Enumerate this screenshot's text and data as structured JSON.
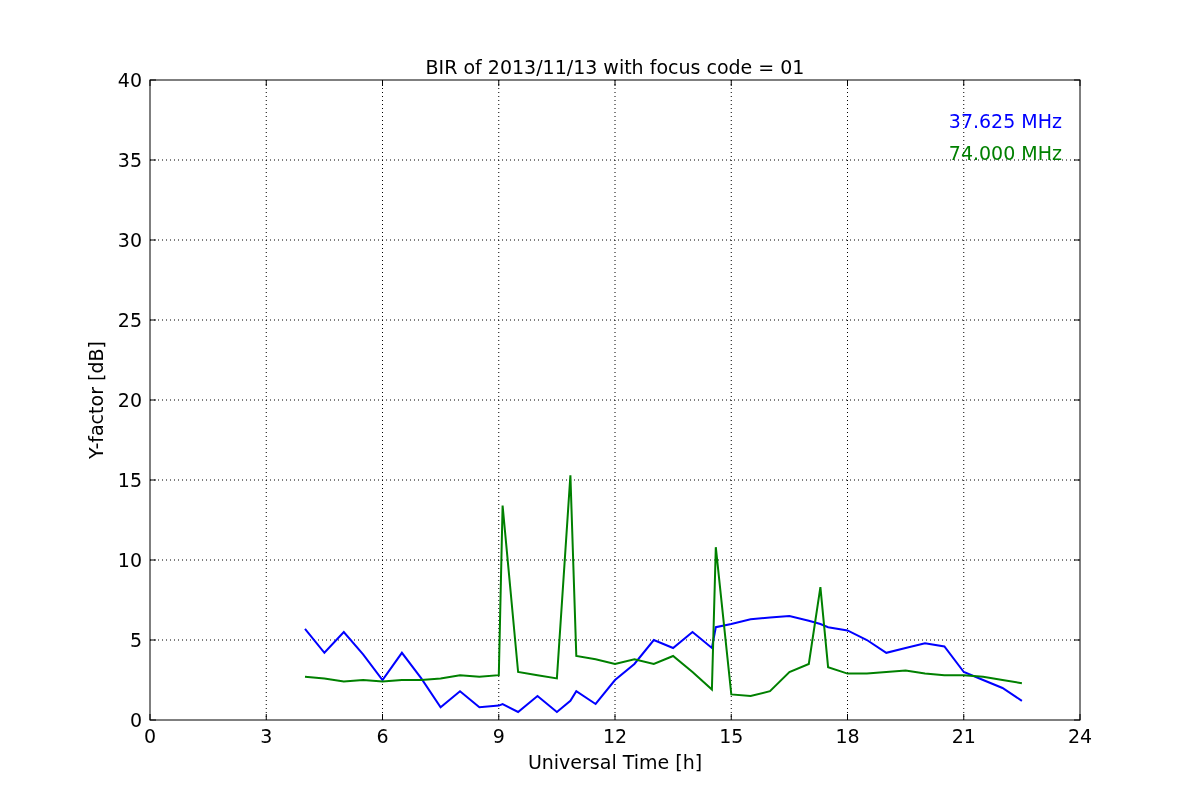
{
  "chart": {
    "chart_data": {
      "type": "line",
      "title": "BIR of 2013/11/13 with focus code = 01",
      "xlabel": "Universal Time [h]",
      "ylabel": "Y-factor [dB]",
      "x": [
        4,
        4.5,
        5,
        5.5,
        6,
        6.5,
        7,
        7.5,
        8,
        8.5,
        9,
        9.1,
        9.5,
        10,
        10.5,
        10.85,
        11,
        11.5,
        12,
        12.5,
        13,
        13.5,
        14,
        14.5,
        14.6,
        15,
        15.5,
        16,
        16.5,
        17,
        17.3,
        17.5,
        18,
        18.5,
        19,
        19.5,
        20,
        20.5,
        21,
        21.5,
        22,
        22.5
      ],
      "series": [
        {
          "name": "37.625 MHz",
          "color": "#0000ff",
          "values": [
            5.7,
            4.2,
            5.5,
            4.1,
            2.5,
            4.2,
            2.6,
            0.8,
            1.8,
            0.8,
            0.9,
            1.0,
            0.5,
            1.5,
            0.5,
            1.2,
            1.8,
            1.0,
            2.5,
            3.5,
            5.0,
            4.5,
            5.5,
            4.5,
            5.8,
            6.0,
            6.3,
            6.4,
            6.5,
            6.2,
            6.0,
            5.8,
            5.6,
            5.0,
            4.2,
            4.5,
            4.8,
            4.6,
            3.0,
            2.5,
            2.0,
            1.2
          ]
        },
        {
          "name": "74.000 MHz",
          "color": "#008000",
          "values": [
            2.7,
            2.6,
            2.4,
            2.5,
            2.4,
            2.5,
            2.5,
            2.6,
            2.8,
            2.7,
            2.8,
            13.4,
            3.0,
            2.8,
            2.6,
            15.3,
            4.0,
            3.8,
            3.5,
            3.8,
            3.5,
            4.0,
            3.0,
            1.9,
            10.8,
            1.6,
            1.5,
            1.8,
            3.0,
            3.5,
            8.3,
            3.3,
            2.9,
            2.9,
            3.0,
            3.1,
            2.9,
            2.8,
            2.8,
            2.7,
            2.5,
            2.3
          ]
        }
      ],
      "grid": true,
      "xlim": [
        0,
        24
      ],
      "ylim": [
        0,
        40
      ],
      "xticks": [
        0,
        3,
        6,
        9,
        12,
        15,
        18,
        21,
        24
      ],
      "yticks": [
        0,
        5,
        10,
        15,
        20,
        25,
        30,
        35,
        40
      ]
    }
  }
}
